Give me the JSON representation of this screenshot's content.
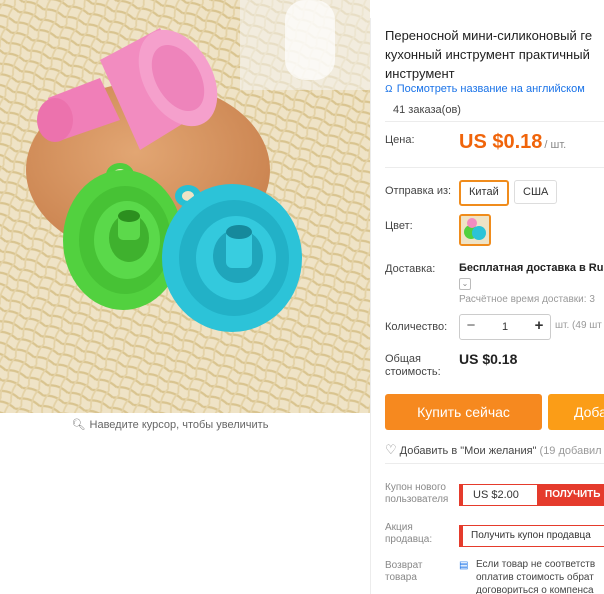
{
  "product": {
    "title": "Переносной мини-силиконовый ге кухонный инструмент практичный инструмент",
    "translate_link": "Посмотреть название на английском",
    "orders": "41 заказа(ов)"
  },
  "gallery": {
    "zoom_hint": "Наведите курсор, чтобы увеличить"
  },
  "price": {
    "label": "Цена:",
    "value": "US $0.18",
    "unit": "/ шт."
  },
  "shipping_from": {
    "label": "Отправка из:",
    "options": [
      "Китай",
      "США"
    ],
    "selected": "Китай"
  },
  "color": {
    "label": "Цвет:"
  },
  "delivery": {
    "label": "Доставка:",
    "value": "Бесплатная доставка в Rus",
    "estimate": "Расчётное время доставки: 3"
  },
  "quantity": {
    "label": "Количество:",
    "value": "1",
    "stock": "шт. (49 шт"
  },
  "total": {
    "label": "Общая стоимость:",
    "value": "US $0.18"
  },
  "actions": {
    "buy_now": "Купить сейчас",
    "add_to_cart": "Доба",
    "wishlist": "Добавить в \"Мои желания\"",
    "wishlist_count": "(19 добавил"
  },
  "coupons": {
    "new_user_label": "Купон нового пользователя",
    "new_user_amount": "US $2.00",
    "new_user_button": "ПОЛУЧИТЬ",
    "seller_label": "Акция продавца:",
    "seller_button": "Получить купон продавца"
  },
  "returns": {
    "label": "Возврат товара",
    "text_line1": "Если товар не соответств",
    "text_line2": "оплатив стоимость обрат",
    "text_line3": "договориться о компенса"
  },
  "colors": {
    "accent_orange": "#f6891f",
    "price_orange": "#f0640a",
    "coupon_red": "#e53b2c",
    "link_blue": "#1a73e8"
  }
}
